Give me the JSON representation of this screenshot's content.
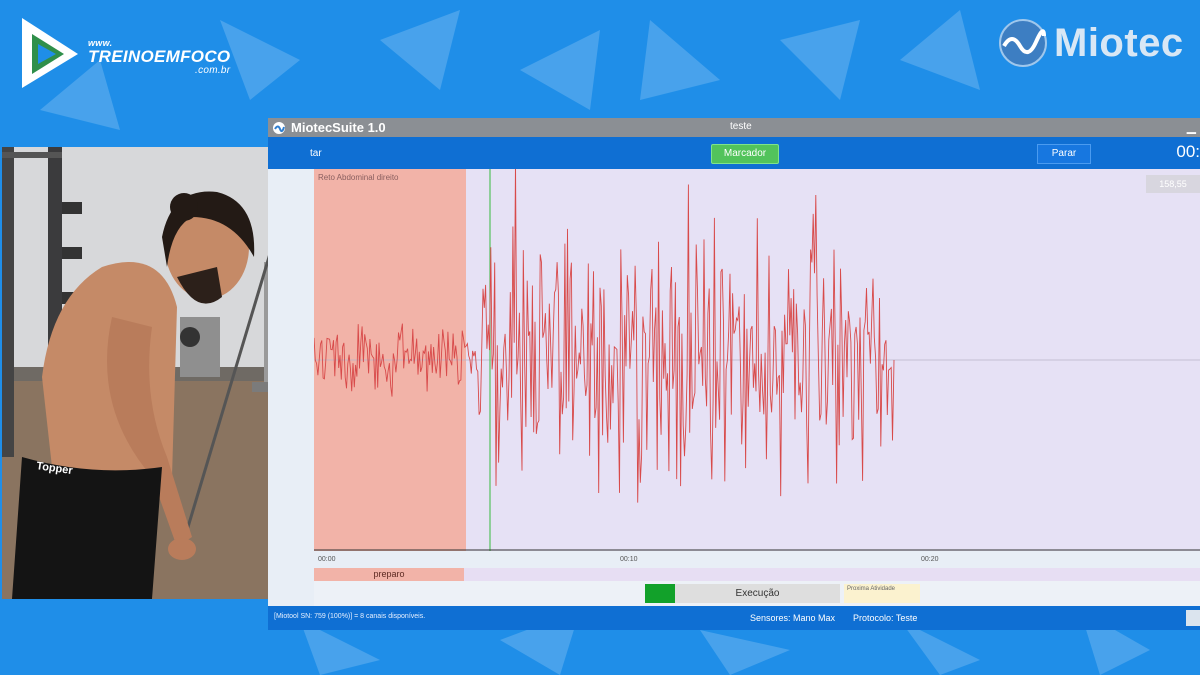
{
  "branding": {
    "left_www": "www.",
    "left_name": "TREINOEMFOCO",
    "left_domain": ".com.br",
    "right_name": "Miotec",
    "logo_left_icon": "play-triangle-icon",
    "logo_right_icon": "globe-wave-icon"
  },
  "app": {
    "title": "MiotecSuite 1.0",
    "document": "teste",
    "toolbar": {
      "left_label": "tar",
      "marker_label": "Marcador",
      "stop_label": "Parar",
      "timer": "00:"
    },
    "plot": {
      "channel_label": "Reto Abdominal direito",
      "value_box": "158,55",
      "ticks": [
        "00:00",
        "00:10",
        "00:20"
      ]
    },
    "phases": {
      "preparo": "preparo",
      "execucao": "Execução",
      "next": "Proxima Atividade"
    },
    "status": {
      "device": "[Miotool SN: 759 (100%)] = 8 canais disponíveis.",
      "sensors": "Sensores: Mano Max",
      "protocol": "Protocolo: Teste"
    }
  },
  "colors": {
    "background": "#1f8ee8",
    "toolbar": "#0f6fd3",
    "marker_button": "#52c35b",
    "signal": "#d84a4a",
    "preparo_region": "#f2b3a8",
    "plot_bg": "#e6e1f5"
  },
  "camera_feed": {
    "brand_on_shorts": "Topper"
  }
}
